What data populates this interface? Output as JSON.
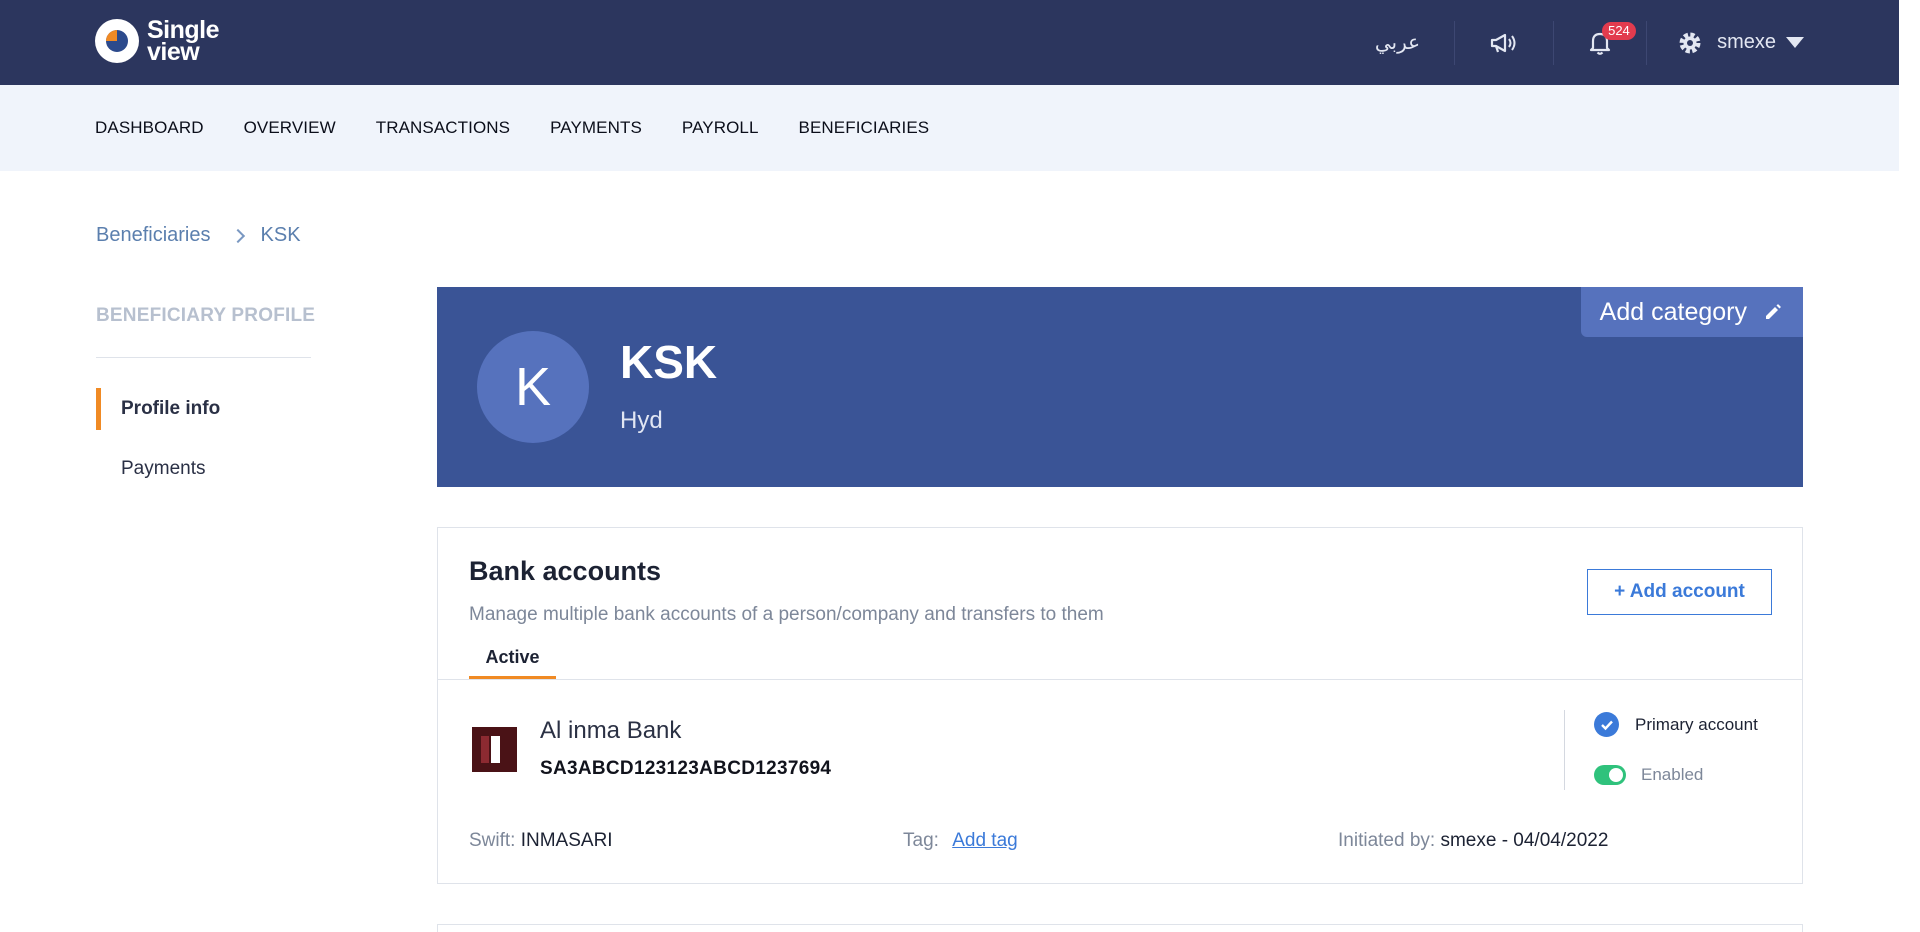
{
  "topbar": {
    "logo_line1": "Single",
    "logo_line2": "view",
    "language": "عربي",
    "notifications_count": "524",
    "user": "smexe"
  },
  "nav": [
    "DASHBOARD",
    "OVERVIEW",
    "TRANSACTIONS",
    "PAYMENTS",
    "PAYROLL",
    "BENEFICIARIES"
  ],
  "breadcrumb": {
    "parent": "Beneficiaries",
    "current": "KSK"
  },
  "sidebar": {
    "title": "BENEFICIARY PROFILE",
    "items": [
      {
        "label": "Profile info",
        "active": true
      },
      {
        "label": "Payments",
        "active": false
      }
    ]
  },
  "profile": {
    "initial": "K",
    "name": "KSK",
    "location": "Hyd",
    "add_category": "Add category"
  },
  "bank": {
    "title": "Bank accounts",
    "description": "Manage multiple bank accounts of a person/company and transfers to them",
    "add_account": "+ Add account",
    "tab": "Active",
    "account": {
      "bank_name": "Al inma Bank",
      "iban": "SA3ABCD123123ABCD1237694",
      "primary_label": "Primary account",
      "enabled_label": "Enabled",
      "swift_label": "Swift:",
      "swift": "INMASARI",
      "tag_label": "Tag:",
      "tag_link": "Add tag",
      "initiated_label": "Initiated by:",
      "initiated_value": "smexe - 04/04/2022"
    }
  },
  "colors": {
    "topbar": "#2c365e",
    "navbar": "#f0f4fb",
    "profile_card": "#3a5496",
    "accent": "#f08a24",
    "link": "#3b7ad9",
    "toggle_on": "#2fc27c"
  }
}
